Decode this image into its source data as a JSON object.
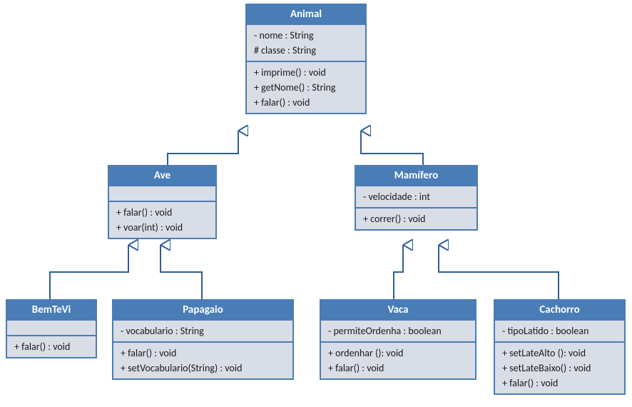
{
  "diagram": {
    "animal": {
      "name": "Animal",
      "attr0": "- nome : String",
      "attr1": "# classe : String",
      "op0": "+ imprime() : void",
      "op1": "+ getNome() : String",
      "op2": "+ falar() : void"
    },
    "ave": {
      "name": "Ave",
      "op0": "+ falar() : void",
      "op1": "+ voar(int) : void"
    },
    "mamifero": {
      "name": "Mamífero",
      "attr0": "- velocidade  : int",
      "op0": "+ correr()  : void"
    },
    "bemtevi": {
      "name": "BemTeVi",
      "op0": "+ falar() : void"
    },
    "papagaio": {
      "name": "Papagaio",
      "attr0": "- vocabulario : String",
      "op0": "+ falar() : void",
      "op1": "+ setVocabulario(String)  : void"
    },
    "vaca": {
      "name": "Vaca",
      "attr0": "- permiteOrdenha : boolean",
      "op0": "+ ordenhar (): void",
      "op1": "+ falar() : void"
    },
    "cachorro": {
      "name": "Cachorro",
      "attr0": "- tipoLatido : boolean",
      "op0": "+ setLateAlto (): void",
      "op1": "+ setLateBaixo() : void",
      "op2": "+ falar() : void"
    }
  }
}
